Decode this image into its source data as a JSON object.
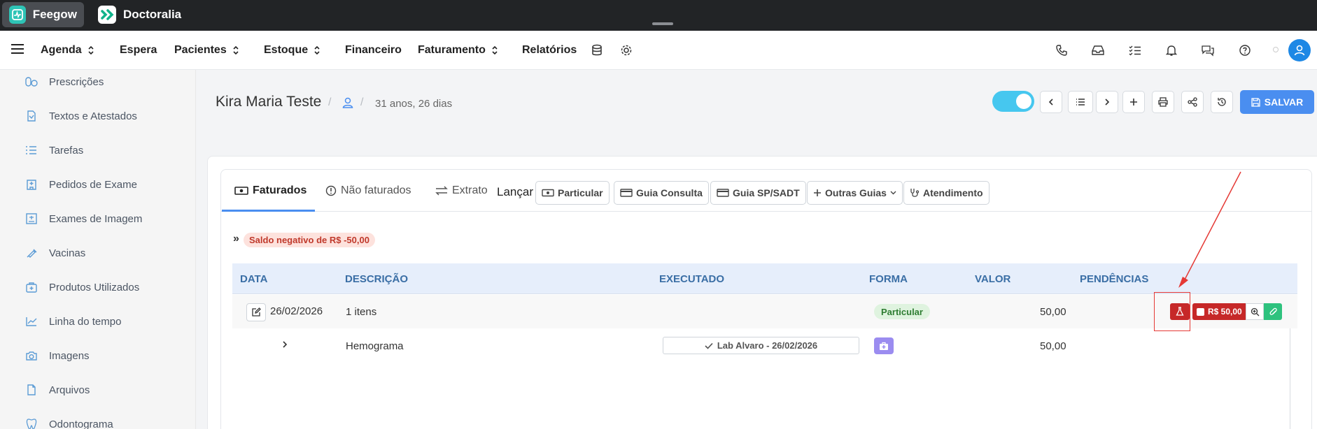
{
  "app_tabs": [
    {
      "label": "Feegow",
      "icon": "feegow-logo-icon"
    },
    {
      "label": "Doctoralia",
      "icon": "doctoralia-logo-icon"
    }
  ],
  "nav": {
    "items": [
      {
        "label": "Agenda",
        "dropdown": true
      },
      {
        "label": "Espera",
        "dropdown": false
      },
      {
        "label": "Pacientes",
        "dropdown": true
      },
      {
        "label": "Estoque",
        "dropdown": true
      },
      {
        "label": "Financeiro",
        "dropdown": false
      },
      {
        "label": "Faturamento",
        "dropdown": true
      },
      {
        "label": "Relatórios",
        "dropdown": false
      }
    ],
    "right_icons": [
      "phone-icon",
      "inbox-icon",
      "tasks-icon",
      "bell-icon",
      "chat-icon",
      "help-icon",
      "user-avatar"
    ]
  },
  "sidebar": {
    "items": [
      {
        "label": "Prescrições",
        "icon": "pills-icon"
      },
      {
        "label": "Textos e Atestados",
        "icon": "document-icon"
      },
      {
        "label": "Tarefas",
        "icon": "list-icon"
      },
      {
        "label": "Pedidos de Exame",
        "icon": "hospital-icon"
      },
      {
        "label": "Exames de Imagem",
        "icon": "image-scan-icon"
      },
      {
        "label": "Vacinas",
        "icon": "syringe-icon"
      },
      {
        "label": "Produtos Utilizados",
        "icon": "medkit-icon"
      },
      {
        "label": "Linha do tempo",
        "icon": "chart-line-icon"
      },
      {
        "label": "Imagens",
        "icon": "camera-icon"
      },
      {
        "label": "Arquivos",
        "icon": "file-icon"
      },
      {
        "label": "Odontograma",
        "icon": "tooth-icon"
      }
    ]
  },
  "header": {
    "patient_name": "Kira Maria Teste",
    "separator": "/",
    "age": "31 anos, 26 dias",
    "save_label": "SALVAR",
    "toggle_on": true
  },
  "tabs": [
    {
      "label": "Faturados",
      "active": true
    },
    {
      "label": "Não faturados",
      "active": false
    },
    {
      "label": "Extrato",
      "active": false
    }
  ],
  "lancar": {
    "label": "Lançar",
    "buttons": [
      "Particular",
      "Guia Consulta",
      "Guia SP/SADT",
      "Outras Guias",
      "Atendimento"
    ]
  },
  "balance": {
    "chevrons": "»",
    "text": "Saldo negativo de R$ -50,00"
  },
  "table": {
    "columns": [
      "DATA",
      "DESCRIÇÃO",
      "EXECUTADO",
      "FORMA",
      "VALOR",
      "PENDÊNCIAS"
    ],
    "row": {
      "date": "26/02/2026",
      "description": "1 itens",
      "forma": "Particular",
      "valor": "50,00",
      "amount_button": "R$ 50,00"
    },
    "subrow": {
      "description": "Hemograma",
      "executado": "Lab Alvaro - 26/02/2026",
      "valor": "50,00"
    }
  },
  "colors": {
    "primary": "#4a8ef0",
    "danger": "#c62828",
    "success": "#2ec27e",
    "toggle": "#46c7ef"
  }
}
